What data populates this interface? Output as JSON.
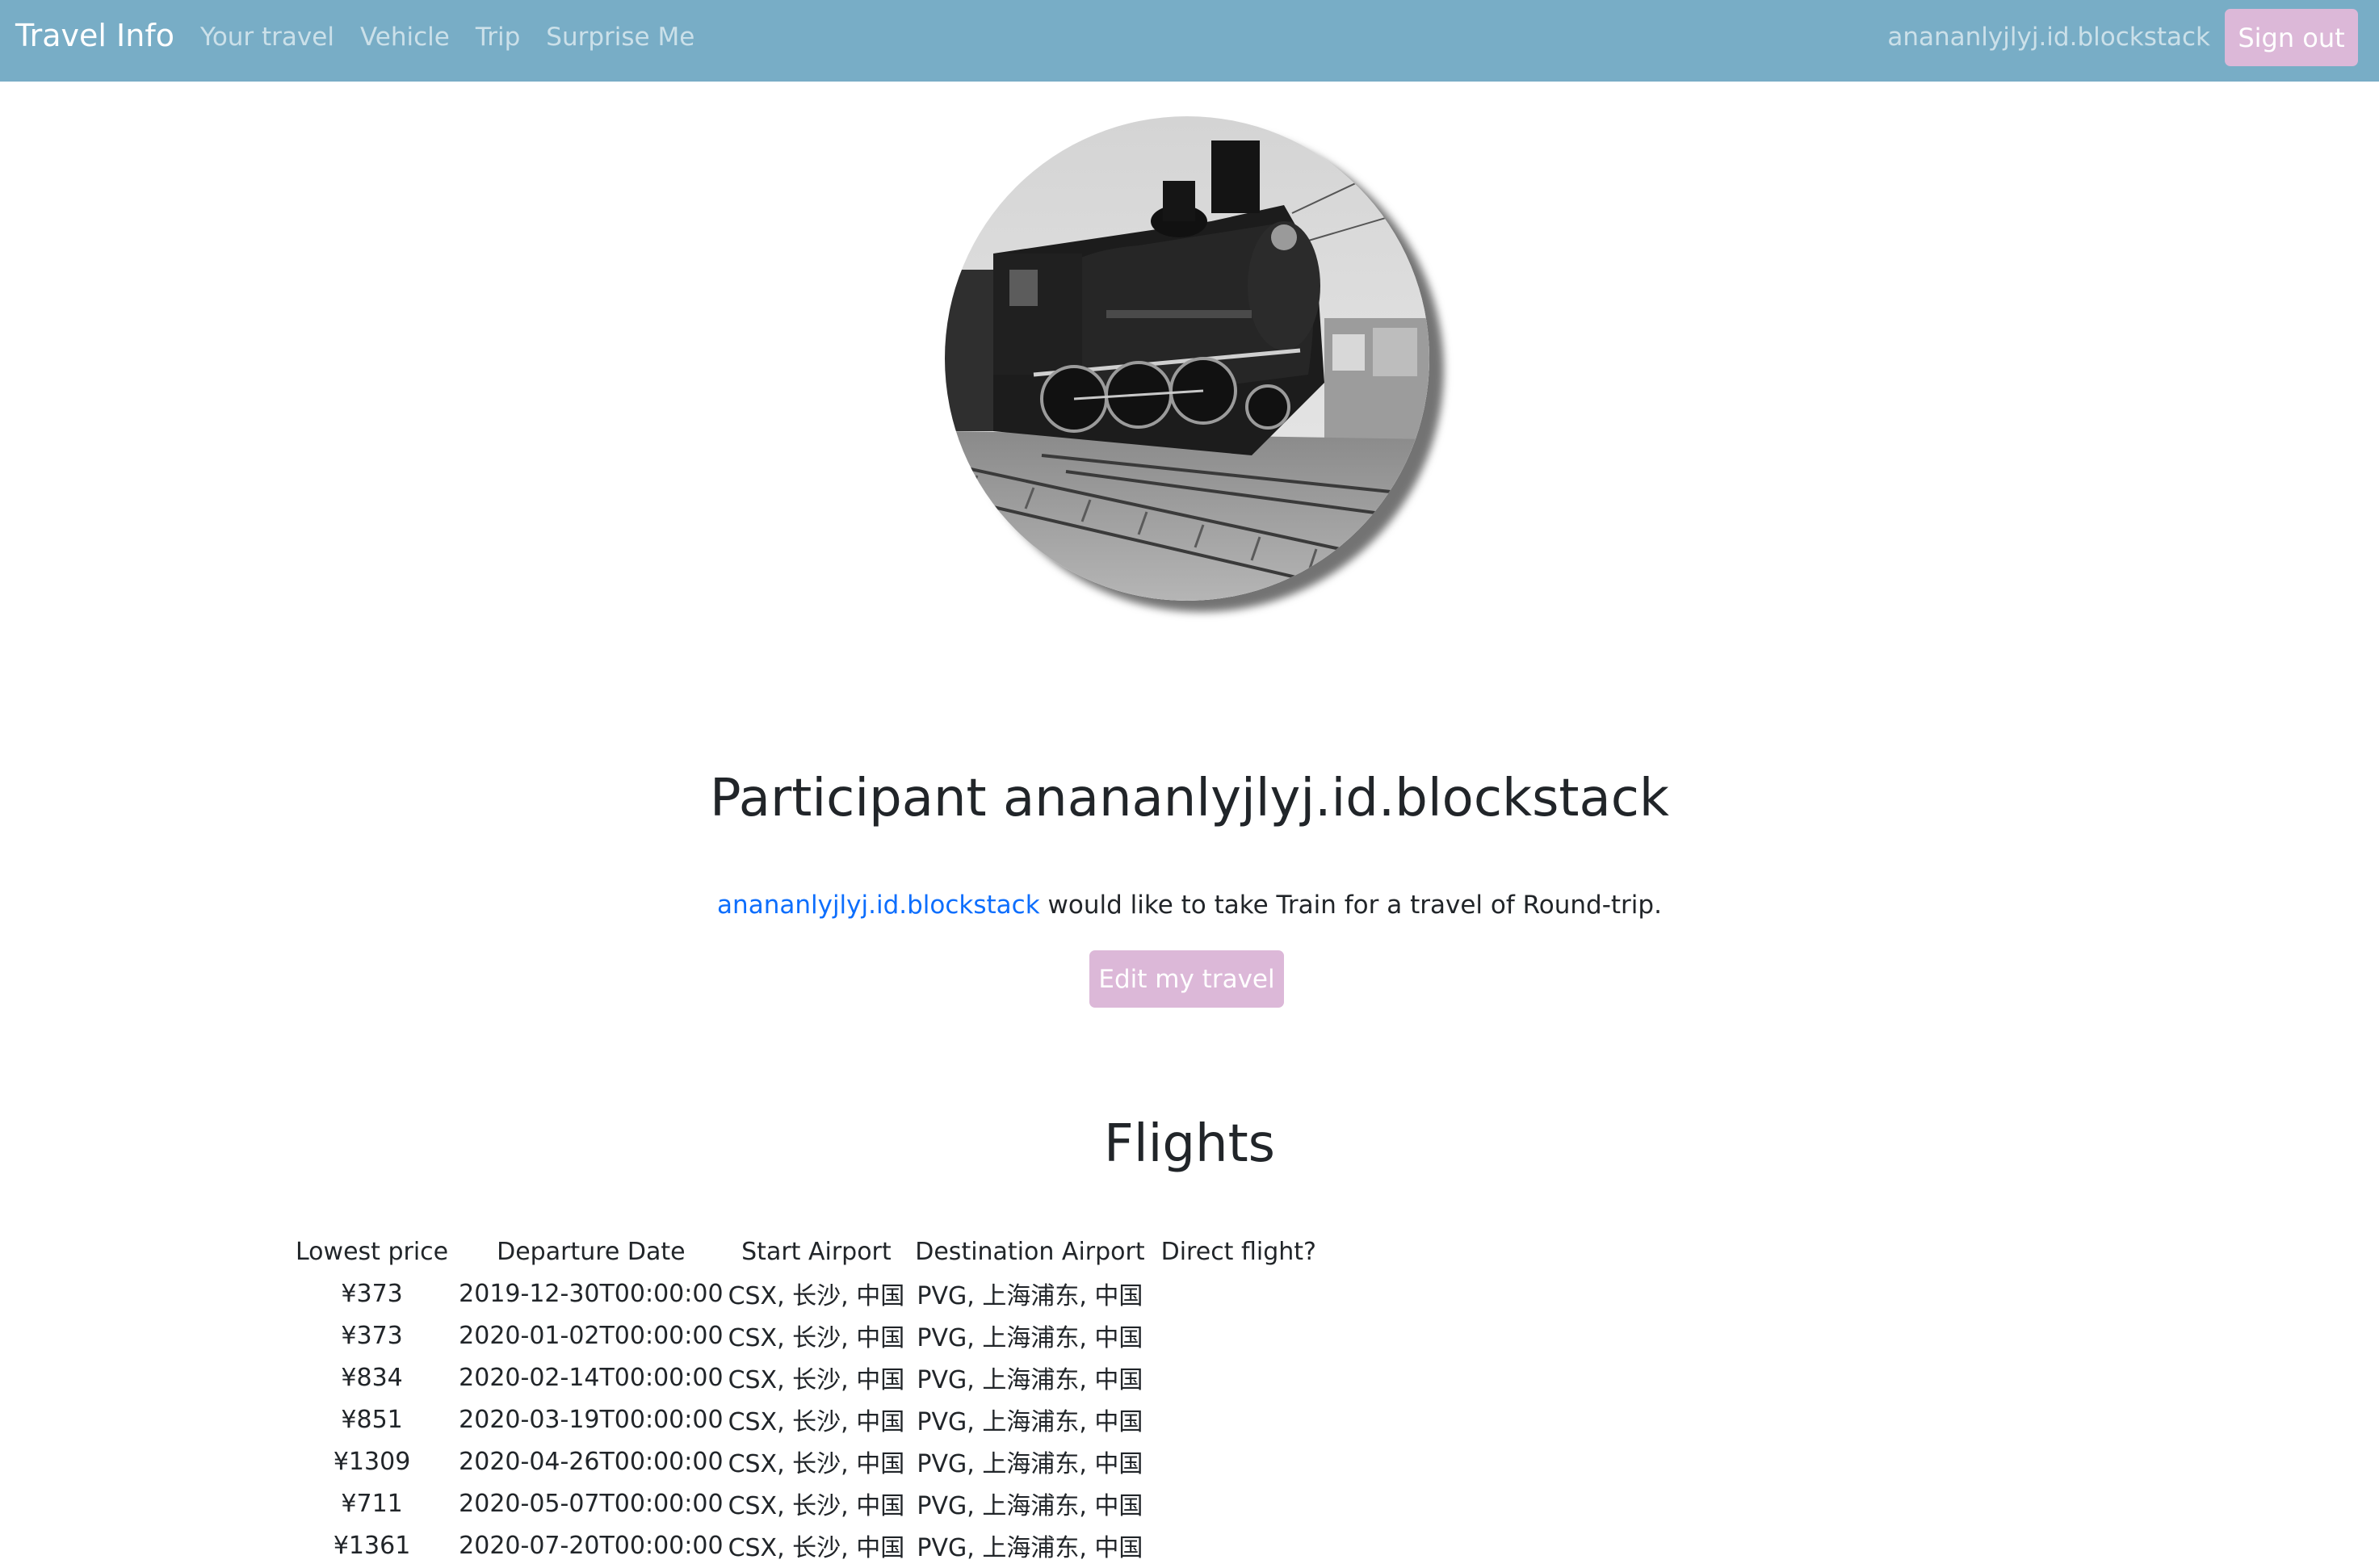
{
  "navbar": {
    "brand": "Travel Info",
    "links": [
      "Your travel",
      "Vehicle",
      "Trip",
      "Surprise Me"
    ],
    "username": "anananlyjlyj.id.blockstack",
    "signout_label": "Sign out"
  },
  "profile": {
    "image_icon": "steam-locomotive-photo",
    "title": "Participant anananlyjlyj.id.blockstack",
    "user_link": "anananlyjlyj.id.blockstack",
    "description": " would like to take Train for a travel of Round-trip.",
    "edit_label": "Edit my travel"
  },
  "flights": {
    "title": "Flights",
    "columns": [
      "Lowest price",
      "Departure Date",
      "Start Airport",
      "Destination Airport",
      "Direct flight?"
    ],
    "rows": [
      {
        "price": "¥373",
        "date": "2019-12-30T00:00:00",
        "start": "CSX, 长沙, 中国",
        "dest": "PVG, 上海浦东, 中国",
        "direct": ""
      },
      {
        "price": "¥373",
        "date": "2020-01-02T00:00:00",
        "start": "CSX, 长沙, 中国",
        "dest": "PVG, 上海浦东, 中国",
        "direct": ""
      },
      {
        "price": "¥834",
        "date": "2020-02-14T00:00:00",
        "start": "CSX, 长沙, 中国",
        "dest": "PVG, 上海浦东, 中国",
        "direct": ""
      },
      {
        "price": "¥851",
        "date": "2020-03-19T00:00:00",
        "start": "CSX, 长沙, 中国",
        "dest": "PVG, 上海浦东, 中国",
        "direct": ""
      },
      {
        "price": "¥1309",
        "date": "2020-04-26T00:00:00",
        "start": "CSX, 长沙, 中国",
        "dest": "PVG, 上海浦东, 中国",
        "direct": ""
      },
      {
        "price": "¥711",
        "date": "2020-05-07T00:00:00",
        "start": "CSX, 长沙, 中国",
        "dest": "PVG, 上海浦东, 中国",
        "direct": ""
      },
      {
        "price": "¥1361",
        "date": "2020-07-20T00:00:00",
        "start": "CSX, 长沙, 中国",
        "dest": "PVG, 上海浦东, 中国",
        "direct": ""
      }
    ]
  },
  "colors": {
    "navbar_bg": "#78adc6",
    "button_bg": "#dcb8d8",
    "link": "#0d6efd"
  }
}
